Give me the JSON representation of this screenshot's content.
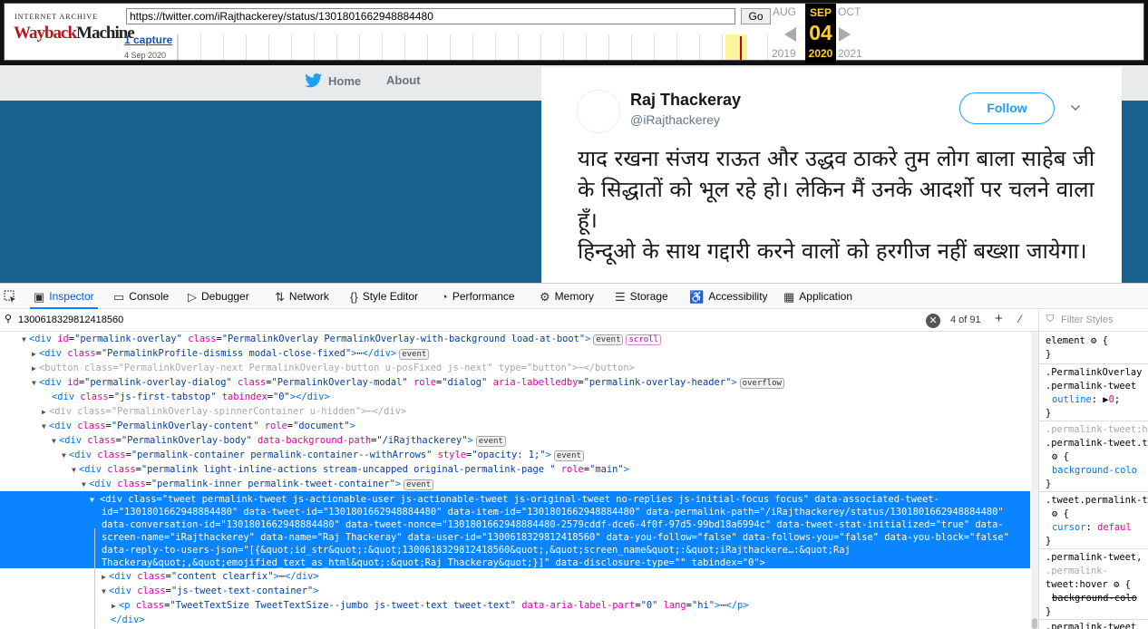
{
  "wayback": {
    "logo_line1": "INTERNET ARCHIVE",
    "logo_w1": "Wayback",
    "logo_w2": "Machine",
    "url": "https://twitter.com/iRajthackerey/status/1301801662948884480",
    "go_label": "Go",
    "captures": "1 capture",
    "capture_date": "4 Sep 2020",
    "prev_month": "AUG",
    "cur_month": "SEP",
    "cur_day": "04",
    "next_month": "OCT",
    "prev_year": "2019",
    "cur_year": "2020",
    "next_year": "2021",
    "colors": {
      "accent": "#ffd12a",
      "bar": "#cc0000"
    }
  },
  "twitter": {
    "nav_home": "Home",
    "nav_about": "About",
    "user_name": "Raj Thackeray",
    "user_handle": "@iRajthackerey",
    "follow_label": "Follow",
    "tweet_text": "याद रखना संजय राऊत और उद्धव ठाकरे तुम लोग बाला साहेब जी के सिद्धातों को भूल रहे हो। लेकिन मैं उनके आदर्शो पर चलने वाला हूँ।\nहिन्दूओ के साथ गद्दारी करने वालों को हरगीज नहीं बख्शा जायेगा।",
    "colors": {
      "brand": "#1da1f2",
      "background": "#1a618f"
    }
  },
  "devtools": {
    "tabs": [
      "Inspector",
      "Console",
      "Debugger",
      "Network",
      "Style Editor",
      "Performance",
      "Memory",
      "Storage",
      "Accessibility",
      "Application"
    ],
    "search_query": "1300618329812418560",
    "search_count": "4 of 91",
    "filter_placeholder": "Filter Styles",
    "badge_event": "event",
    "badge_scroll": "scroll",
    "badge_overflow": "overflow",
    "selected_html": "<div class=\"tweet permalink-tweet js-actionable-user js-actionable-tweet js-original-tweet no-replies js-initial-focus focus\" data-associated-tweet-id=\"1301801662948884480\" data-tweet-id=\"1301801662948884480\" data-item-id=\"1301801662948884480\" data-permalink-path=\"/iRajthackerey/status/1301801662948884480\" data-conversation-id=\"1301801662948884480\" data-tweet-nonce=\"1301801662948884480-2579cddf-dce6-4f0f-97d5-99bd18a6994c\" data-tweet-stat-initialized=\"true\" data-screen-name=\"iRajthackerey\" data-name=\"Raj Thackeray\" data-user-id=\"1300618329812418560\" data-you-follow=\"false\" data-follows-you=\"false\" data-you-block=\"false\" data-reply-to-users-json=\"[{&quot;id_str&quot;:&quot;1300618329812418560&quot;,&quot;screen_name&quot;:&quot;iRajthackere…:&quot;Raj Thackeray&quot;,&quot;emojified_text_as_html&quot;:&quot;Raj Thackeray&quot;}]\" data-disclosure-type=\"\" tabindex=\"0\">",
    "side_rules": [
      "element",
      ".PermalinkOverlay",
      ".permalink-tweet",
      "outline",
      "0",
      ".permalink-tweet:h",
      ".permalink-tweet.t",
      "background-colo",
      ".tweet.permalink-t",
      "cursor",
      "defaul",
      ".permalink-tweet,",
      ".permalink-",
      "tweet:hover",
      "background-colo",
      ".permalink-tweet"
    ]
  }
}
